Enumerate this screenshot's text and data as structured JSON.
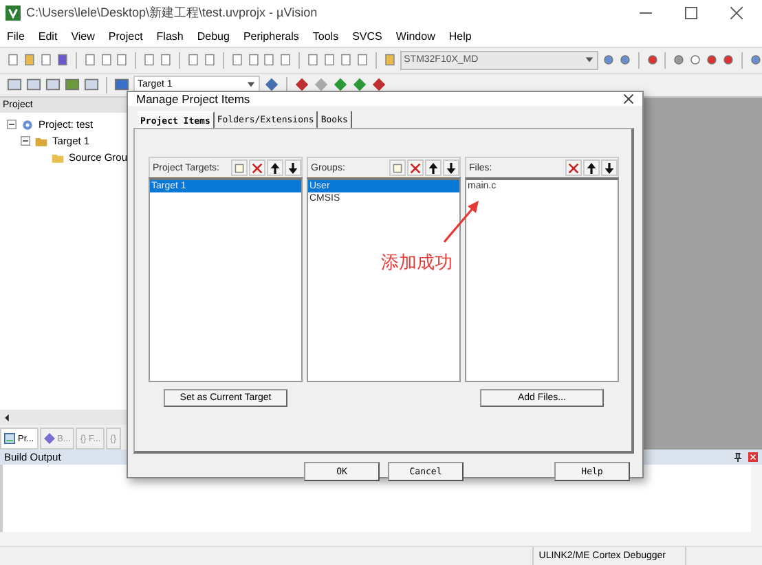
{
  "window": {
    "title": "C:\\Users\\lele\\Desktop\\新建工程\\test.uvprojx - µVision"
  },
  "menu": [
    "File",
    "Edit",
    "View",
    "Project",
    "Flash",
    "Debug",
    "Peripherals",
    "Tools",
    "SVCS",
    "Window",
    "Help"
  ],
  "toolbar": {
    "device": "STM32F10X_MD",
    "target": "Target 1"
  },
  "project_panel": {
    "title": "Project",
    "tree": [
      {
        "label": "Project: test",
        "expanded": true,
        "children": [
          {
            "label": "Target 1",
            "expanded": true,
            "children": [
              {
                "label": "Source Grou"
              }
            ]
          }
        ]
      }
    ],
    "tabs": [
      {
        "label": "Pr...",
        "kind": "project",
        "selected": true
      },
      {
        "label": "B...",
        "kind": "books",
        "selected": false
      },
      {
        "label": "{} F...",
        "kind": "text",
        "selected": false
      },
      {
        "label": "{}",
        "kind": "text",
        "selected": false
      }
    ]
  },
  "build_output": {
    "title": "Build Output"
  },
  "status_bar": {
    "debugger": "ULINK2/ME Cortex Debugger"
  },
  "dialog": {
    "title": "Manage Project Items",
    "tabs": [
      {
        "label": "Project Items",
        "selected": true
      },
      {
        "label": "Folders/Extensions",
        "selected": false
      },
      {
        "label": "Books",
        "selected": false
      }
    ],
    "lists": [
      {
        "label": "Project Targets:",
        "tools": [
          {
            "kind": "new"
          },
          {
            "kind": "delete"
          },
          {
            "kind": "up"
          },
          {
            "kind": "down"
          }
        ],
        "items": [
          {
            "label": "Target 1",
            "selected": true
          }
        ],
        "button": "Set as Current Target"
      },
      {
        "label": "Groups:",
        "tools": [
          {
            "kind": "new"
          },
          {
            "kind": "delete"
          },
          {
            "kind": "up"
          },
          {
            "kind": "down"
          }
        ],
        "items": [
          {
            "label": "User",
            "selected": true
          },
          {
            "label": "CMSIS",
            "selected": false
          }
        ]
      },
      {
        "label": "Files:",
        "tools": [
          {
            "kind": "delete"
          },
          {
            "kind": "up"
          },
          {
            "kind": "down"
          }
        ],
        "items": [
          {
            "label": "main.c",
            "selected": false
          }
        ],
        "button": "Add Files..."
      }
    ],
    "buttons": [
      "OK",
      "Cancel",
      "Help"
    ]
  },
  "annotation": {
    "text": "添加成功"
  }
}
